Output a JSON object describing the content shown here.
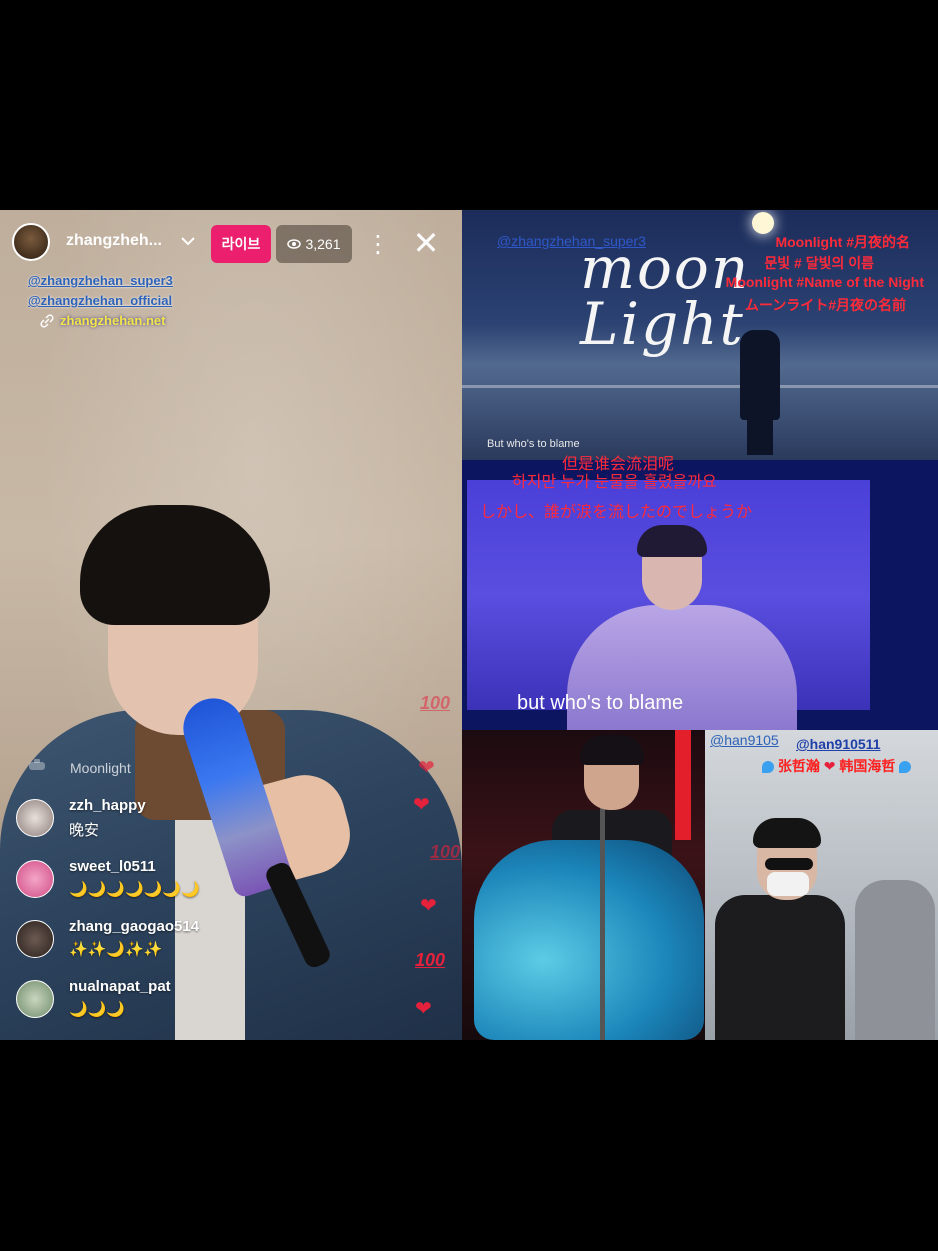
{
  "live": {
    "username": "zhangzheh...",
    "live_badge": "라이브",
    "viewer_count": "3,261",
    "overlay": {
      "handle1": "@zhangzhehan_super3",
      "handle2": "@zhangzhehan_official",
      "link": "zhangzhehan.net"
    },
    "music_label": "Moonlight",
    "comments": [
      {
        "name": "zzh_happy",
        "text": "晚安"
      },
      {
        "name": "sweet_l0511",
        "text": "🌙🌙🌙🌙🌙🌙🌙"
      },
      {
        "name": "zhang_gaogao514",
        "text": "✨✨🌙✨✨"
      },
      {
        "name": "nualnapat_pat",
        "text": "🌙🌙🌙"
      }
    ],
    "reactions": {
      "heart": "❤",
      "hundred": "100"
    },
    "icons": {
      "chevron": "chevron-down-icon",
      "eye": "eye-icon",
      "more": "more-vertical-icon",
      "close": "close-icon",
      "link": "link-icon",
      "music": "music-icon"
    },
    "colors": {
      "live_badge": "#ec1f6e",
      "heart": "#e5213b"
    }
  },
  "collage": {
    "tile1": {
      "handle": "@zhangzhehan_super3",
      "title_art": "moon Light",
      "title_lines": [
        "Moonlight #月夜的名",
        "문빛 # 달빛의 이름",
        "Moonlight #Name of the Night",
        "ムーンライト#月夜の名前"
      ],
      "small_caption": "But who's to blame"
    },
    "tile2": {
      "subtitle_zh": "但是谁会流泪呢",
      "subtitle_ko": "하지만 누가 눈물을 흘렸을까요",
      "subtitle_ja": "しかし、誰が涙を流したのでしょうか",
      "subtitle_en": "but who's to blame"
    },
    "tile4": {
      "handle1": "@han9105",
      "handle2": "@han910511",
      "caption_left": "张哲瀚",
      "caption_right": "韩国海哲"
    }
  }
}
